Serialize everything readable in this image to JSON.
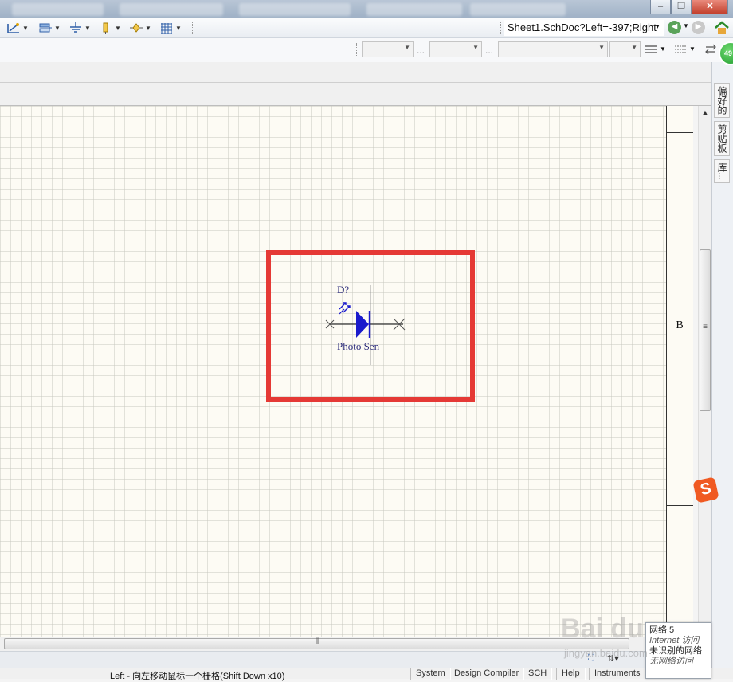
{
  "window": {
    "minimize_glyph": "–",
    "restore_glyph": "❐",
    "close_glyph": "✕"
  },
  "toolbar": {
    "icons": [
      "wire-icon",
      "bus-icon",
      "ground-icon",
      "port-icon",
      "part-icon",
      "grid-icon"
    ],
    "address": "Sheet1.SchDoc?Left=-397;Right",
    "address_dropdown": "▾"
  },
  "toolbar2": {
    "ellipsis": "..."
  },
  "schematic": {
    "designator": "D?",
    "comment": "Photo Sen",
    "zone_letter": "B",
    "highlight_color": "#e53935",
    "component_color": "#1a1acc"
  },
  "side_panel": {
    "tabs": [
      "偏好的",
      "剪贴板",
      "库..."
    ],
    "badge": "49"
  },
  "statusbar": {
    "message": "Left - 向左移动鼠标一个栅格(Shift Down x10)",
    "buttons": [
      "System",
      "Design Compiler",
      "SCH",
      "Help",
      "Instruments"
    ]
  },
  "network_popup": {
    "line1": "网络 5",
    "line2": "Internet 访问",
    "line3": "未识别的网络",
    "line4": "无网络访问"
  },
  "watermark": {
    "text": "Bai du",
    "sub": "jingyan.baidu.com"
  }
}
